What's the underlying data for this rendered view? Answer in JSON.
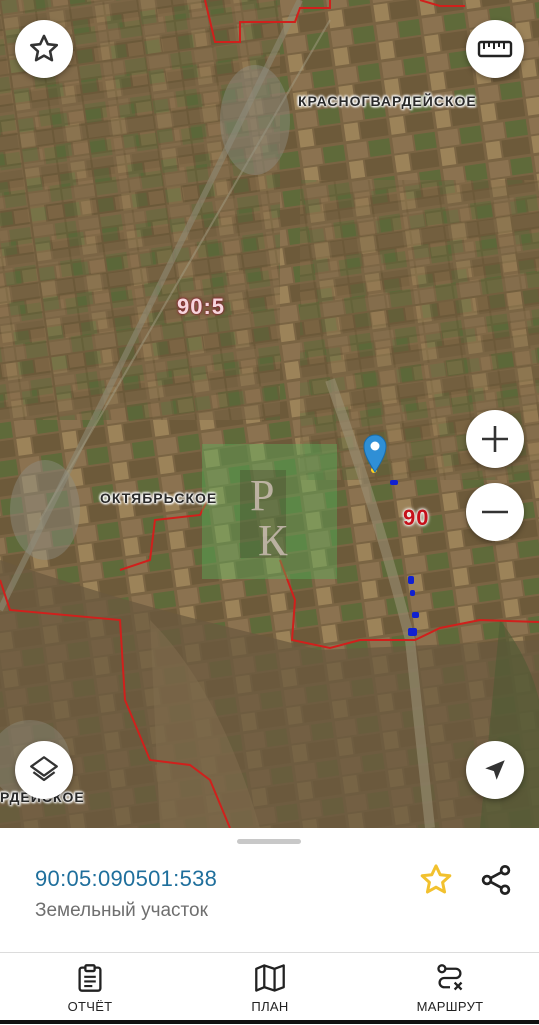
{
  "map": {
    "labels": {
      "krasnogvardeyskoe": "КРАСНОГВАРДЕЙСКОЕ",
      "oktyabrskoe": "ОКТЯБРЬСКОЕ",
      "gvardeyskoe_partial": "РДЕЙСКОЕ",
      "district_code": "90:5",
      "region_code": "90"
    },
    "watermark": {
      "letter_top": "Р",
      "letter_bottom": "К"
    },
    "colors": {
      "boundary": "#d0201c",
      "region_code": "#c5101a",
      "district_code": "#f6d4dc"
    }
  },
  "controls": {
    "favorite": "star-outline-icon",
    "ruler": "ruler-icon",
    "zoom_in": "plus-icon",
    "zoom_out": "minus-icon",
    "layers": "layers-icon",
    "locate": "navigation-arrow-icon"
  },
  "parcel": {
    "cadastral_number": "90:05:090501:538",
    "type": "Земельный участок",
    "favorite_color": "#f2c12e"
  },
  "nav": {
    "items": [
      {
        "label": "ОТЧЁТ",
        "icon": "clipboard-report-icon"
      },
      {
        "label": "ПЛАН",
        "icon": "map-plan-icon"
      },
      {
        "label": "МАРШРУТ",
        "icon": "route-icon"
      }
    ]
  }
}
